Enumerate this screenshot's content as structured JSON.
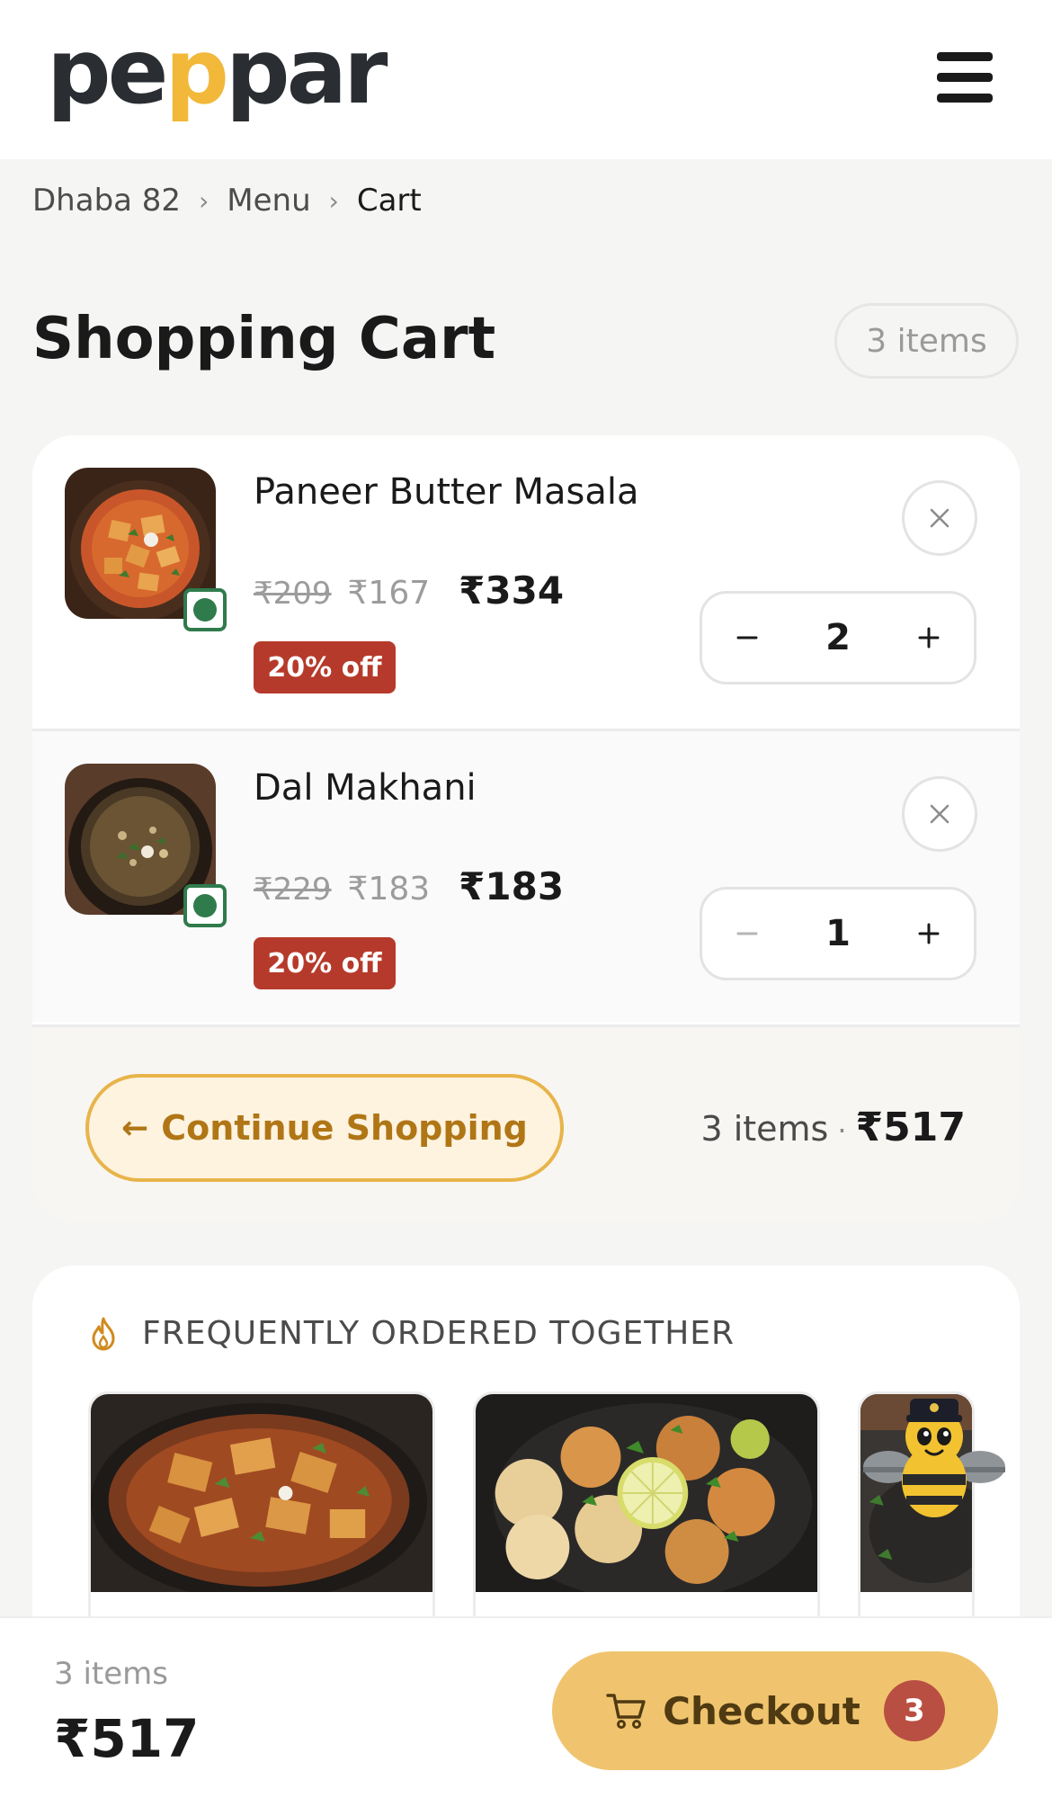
{
  "header": {
    "logo_parts": [
      "pe",
      "p",
      "par"
    ],
    "menu_icon": "hamburger-menu-icon"
  },
  "breadcrumb": {
    "items": [
      "Dhaba 82",
      "Menu",
      "Cart"
    ],
    "separator_icon": "chevron-right-icon"
  },
  "page": {
    "title": "Shopping Cart",
    "count": "3 items"
  },
  "cart": {
    "items": [
      {
        "name": "Paneer Butter Masala",
        "old_price": "₹209",
        "unit_price": "₹167",
        "total_price": "₹334",
        "discount": "20% off",
        "quantity": "2",
        "veg": true
      },
      {
        "name": "Dal Makhani",
        "old_price": "₹229",
        "unit_price": "₹183",
        "total_price": "₹183",
        "discount": "20% off",
        "quantity": "1",
        "veg": true
      }
    ],
    "continue_label": "Continue Shopping",
    "summary_items": "3 items",
    "summary_dot": "·",
    "summary_total": "₹517"
  },
  "fot": {
    "title": "FREQUENTLY ORDERED TOGETHER",
    "icon": "flame-icon"
  },
  "bottom_bar": {
    "items": "3 items",
    "total": "₹517",
    "checkout_label": "Checkout",
    "checkout_count": "3",
    "cart_icon": "cart-icon"
  },
  "colors": {
    "accent": "#f0c46e",
    "discount": "#b63a2b",
    "veg": "#2f7b4c",
    "badge": "#b94f42"
  }
}
